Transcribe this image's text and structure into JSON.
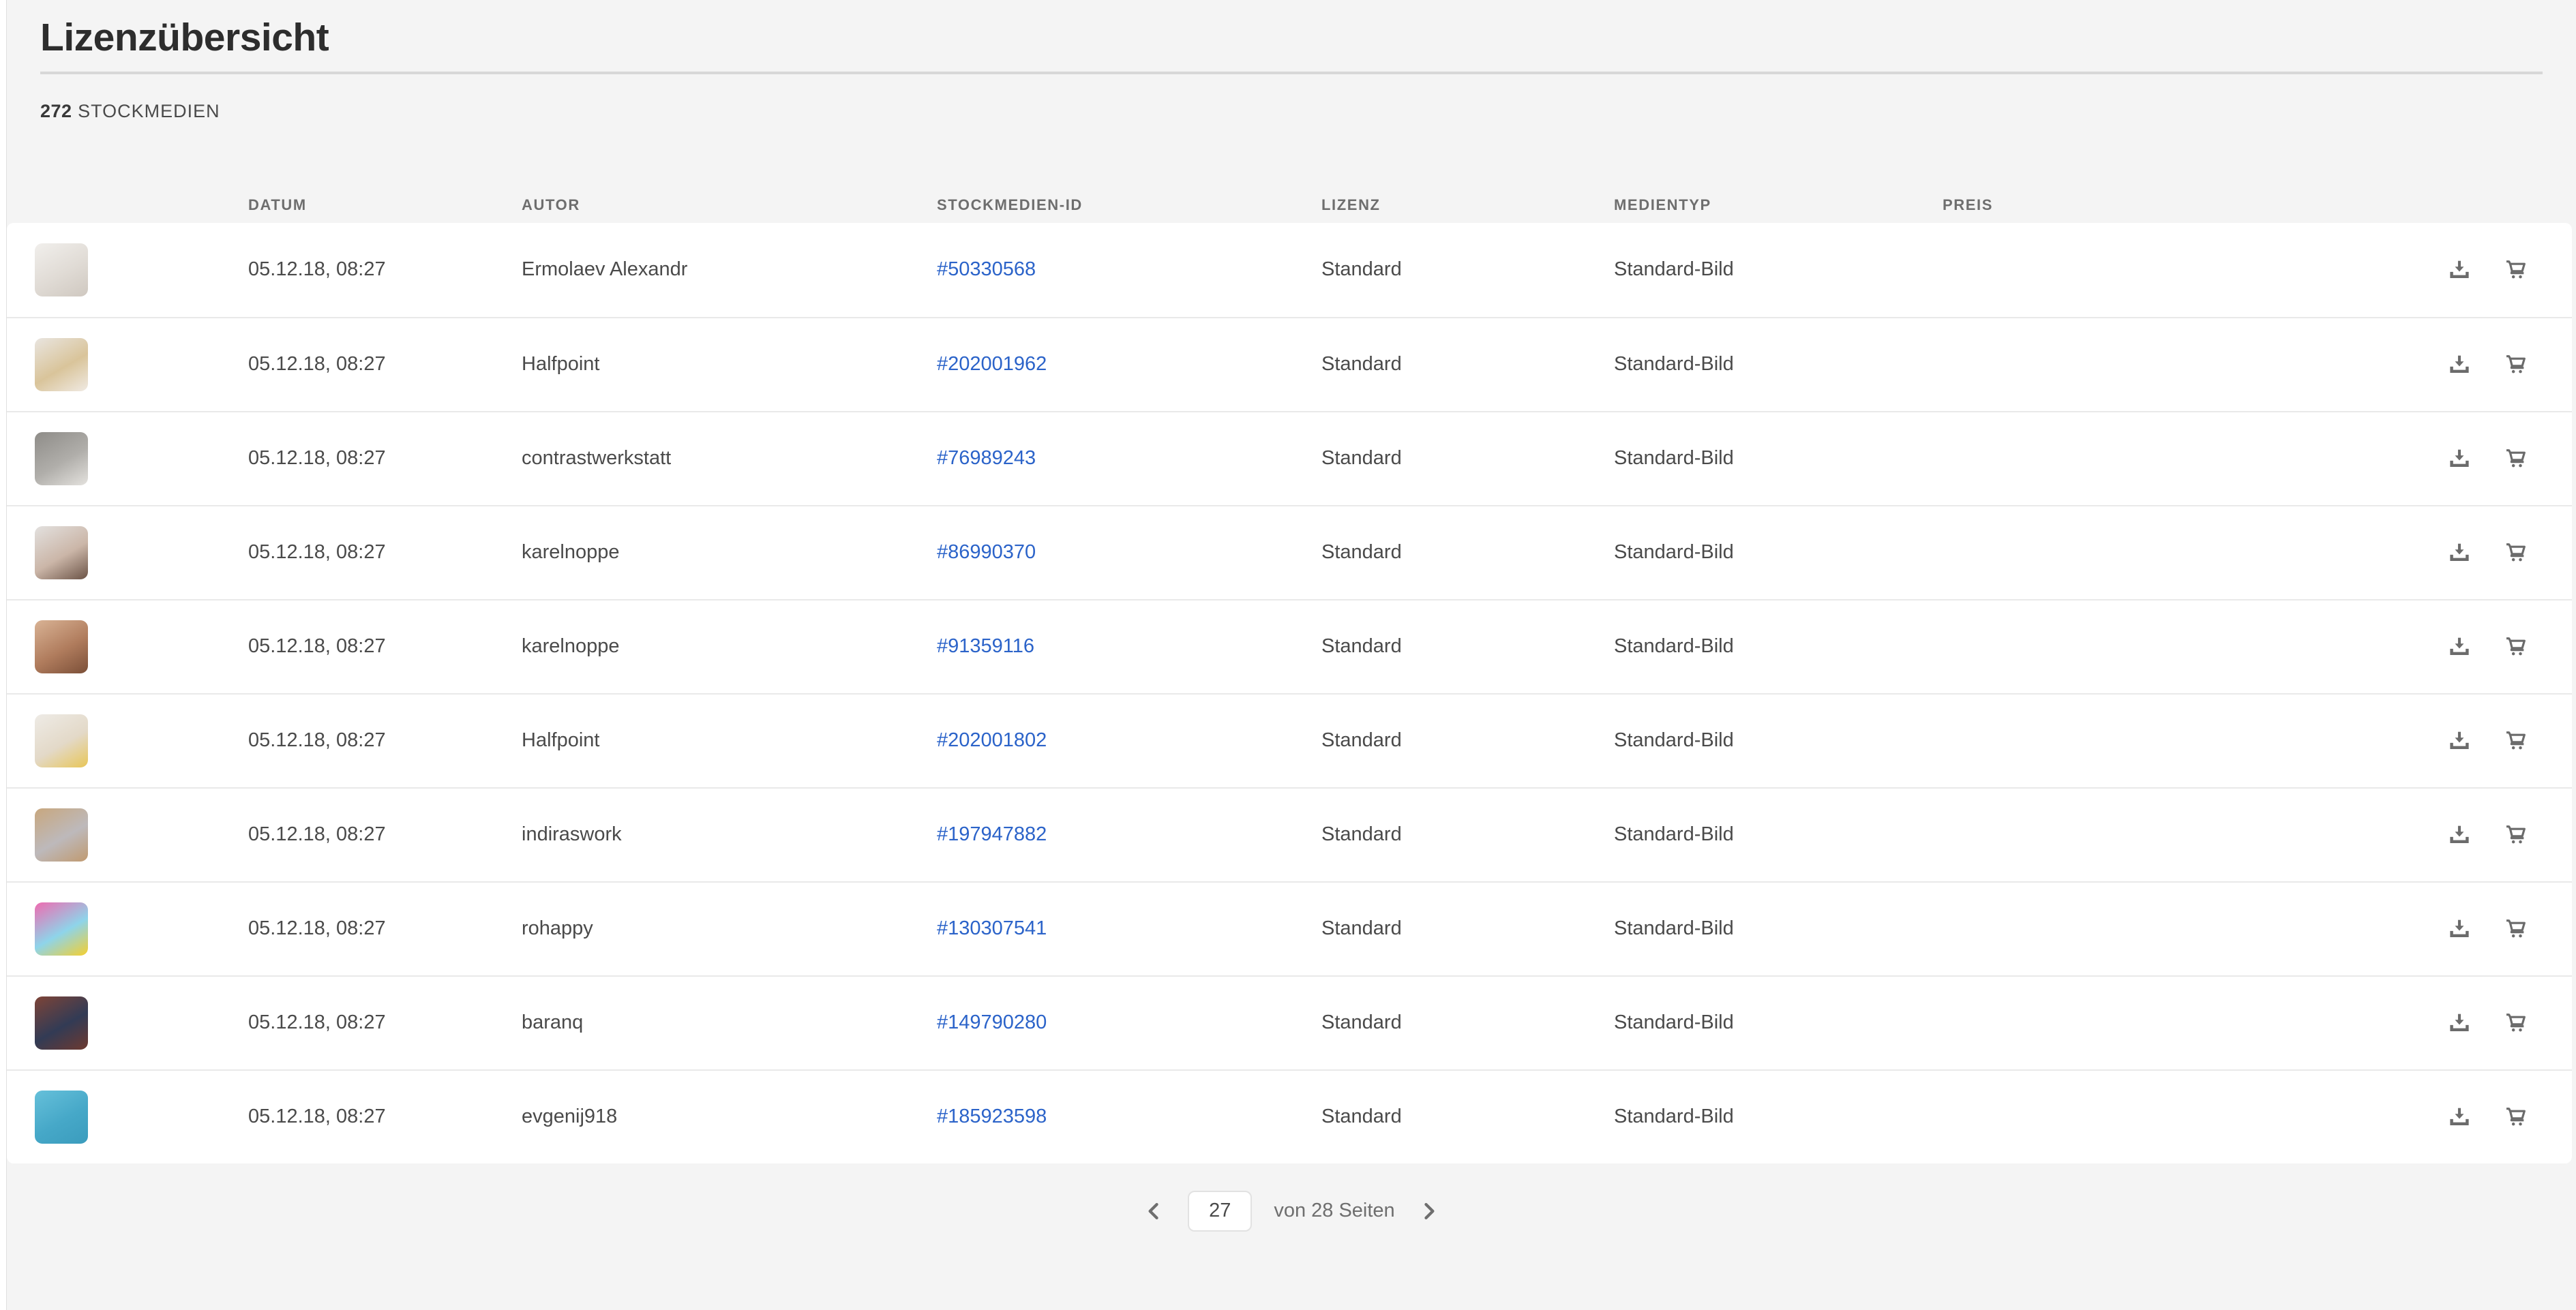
{
  "page": {
    "title": "Lizenzübersicht",
    "media_count": "272",
    "media_count_label": "STOCKMEDIEN"
  },
  "colors": {
    "link_blue": "#2b63c9",
    "panel_background": "#f4f4f4",
    "row_background": "#ffffff",
    "text_dark": "#4a4a4a",
    "text_muted": "#6e6e6e",
    "icon_gray": "#6b6b6b"
  },
  "table": {
    "columns": {
      "date": "DATUM",
      "author": "AUTOR",
      "stock_id": "STOCKMEDIEN-ID",
      "license": "LIZENZ",
      "media_type": "MEDIENTYP",
      "price": "PREIS"
    },
    "rows": [
      {
        "date": "05.12.18, 08:27",
        "author": "Ermolaev Alexandr",
        "stock_id": "#50330568",
        "license": "Standard",
        "media_type": "Standard-Bild",
        "price": "",
        "thumb": {
          "name": "family-in-bed",
          "colors": [
            "#f1efec",
            "#e0dbd5",
            "#cfc8c0"
          ]
        }
      },
      {
        "date": "05.12.18, 08:27",
        "author": "Halfpoint",
        "stock_id": "#202001962",
        "license": "Standard",
        "media_type": "Standard-Bild",
        "price": "",
        "thumb": {
          "name": "physio-massage",
          "colors": [
            "#e9e5e0",
            "#d9c49a",
            "#f0eae3"
          ]
        }
      },
      {
        "date": "05.12.18, 08:27",
        "author": "contrastwerkstatt",
        "stock_id": "#76989243",
        "license": "Standard",
        "media_type": "Standard-Bild",
        "price": "",
        "thumb": {
          "name": "group-portrait",
          "colors": [
            "#8e8c88",
            "#b0aeaa",
            "#e4e2de"
          ]
        }
      },
      {
        "date": "05.12.18, 08:27",
        "author": "karelnoppe",
        "stock_id": "#86990370",
        "license": "Standard",
        "media_type": "Standard-Bild",
        "price": "",
        "thumb": {
          "name": "face-massage",
          "colors": [
            "#e3e1df",
            "#cbb6a8",
            "#6b5346"
          ]
        }
      },
      {
        "date": "05.12.18, 08:27",
        "author": "karelnoppe",
        "stock_id": "#91359116",
        "license": "Standard",
        "media_type": "Standard-Bild",
        "price": "",
        "thumb": {
          "name": "back-massage",
          "colors": [
            "#d9b395",
            "#b07c5d",
            "#7b4f38"
          ]
        }
      },
      {
        "date": "05.12.18, 08:27",
        "author": "Halfpoint",
        "stock_id": "#202001802",
        "license": "Standard",
        "media_type": "Standard-Bild",
        "price": "",
        "thumb": {
          "name": "hand-therapy",
          "colors": [
            "#eeebe6",
            "#e3d9c8",
            "#e8c657"
          ]
        }
      },
      {
        "date": "05.12.18, 08:27",
        "author": "indiraswork",
        "stock_id": "#197947882",
        "license": "Standard",
        "media_type": "Standard-Bild",
        "price": "",
        "thumb": {
          "name": "woman-gray-coat",
          "colors": [
            "#c8a77e",
            "#bdb9bb",
            "#c09a70"
          ]
        }
      },
      {
        "date": "05.12.18, 08:27",
        "author": "rohappy",
        "stock_id": "#130307541",
        "license": "Standard",
        "media_type": "Standard-Bild",
        "price": "",
        "thumb": {
          "name": "woman-pink-hat",
          "colors": [
            "#ef6bb0",
            "#8ed4ea",
            "#f5cf2e"
          ]
        }
      },
      {
        "date": "05.12.18, 08:27",
        "author": "baranq",
        "stock_id": "#149790280",
        "license": "Standard",
        "media_type": "Standard-Bild",
        "price": "",
        "thumb": {
          "name": "man-suit-brick-wall",
          "colors": [
            "#7e4437",
            "#323b55",
            "#6e3a30"
          ]
        }
      },
      {
        "date": "05.12.18, 08:27",
        "author": "evgenij918",
        "stock_id": "#185923598",
        "license": "Standard",
        "media_type": "Standard-Bild",
        "price": "",
        "thumb": {
          "name": "woman-blue-studio",
          "colors": [
            "#66c0da",
            "#46a8c8",
            "#3b9cbd"
          ]
        }
      }
    ]
  },
  "pagination": {
    "current_page": "27",
    "total_label": "von 28 Seiten"
  }
}
